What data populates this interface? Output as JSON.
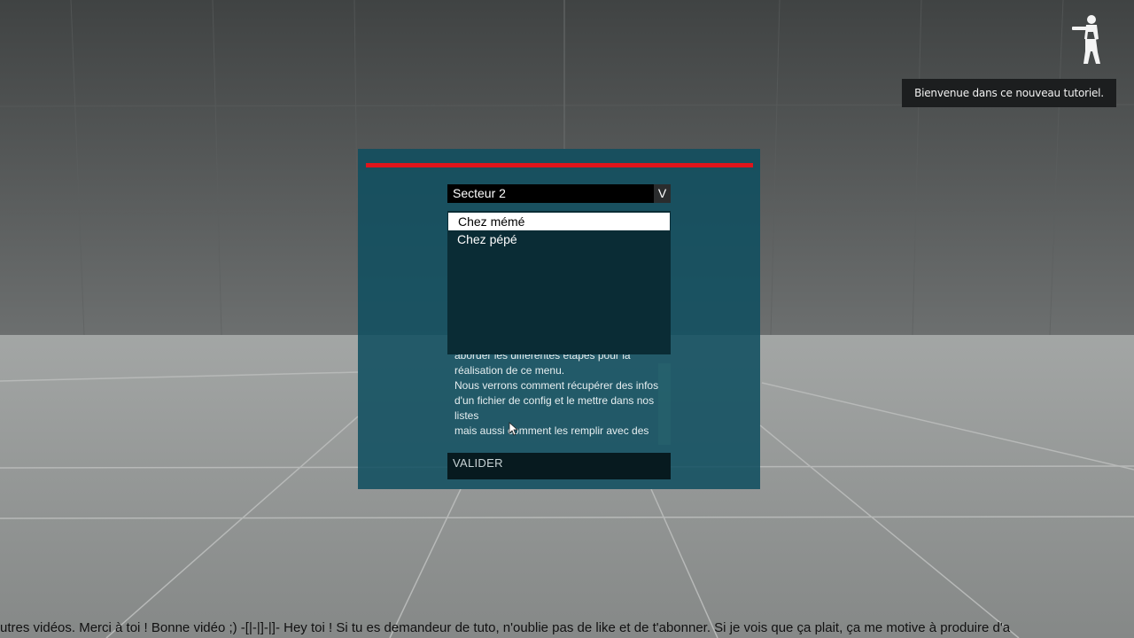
{
  "notification": {
    "text": "Bienvenue dans ce nouveau tutoriel."
  },
  "dialog": {
    "combo": {
      "selected": "Secteur 2",
      "arrow": "V"
    },
    "options": [
      "Chez mémé",
      "Chez pépé"
    ],
    "text_lines": [
      "aborder les différentes étapes pour la",
      "réalisation de ce menu.",
      "Nous verrons comment récupérer des infos",
      "d'un fichier de config et le mettre dans nos",
      "listes",
      "mais aussi comment les remplir avec des"
    ],
    "validate_label": "VALIDER"
  },
  "ticker": {
    "text": "utres vidéos. Merci à toi ! Bonne vidéo ;)     -[|-|]-|]-     Hey toi ! Si tu es demandeur de tuto, n'oublie pas de like et de t'abonner. Si je vois que ça plait, ça me motive à produire d'a"
  },
  "colors": {
    "dialog_bg": "#0e4e60",
    "accent_bar": "#e0141b",
    "notification_bg": "#1c1e1f"
  },
  "icons": [
    "soldier-icon",
    "chevron-down-icon",
    "mouse-cursor-icon"
  ]
}
